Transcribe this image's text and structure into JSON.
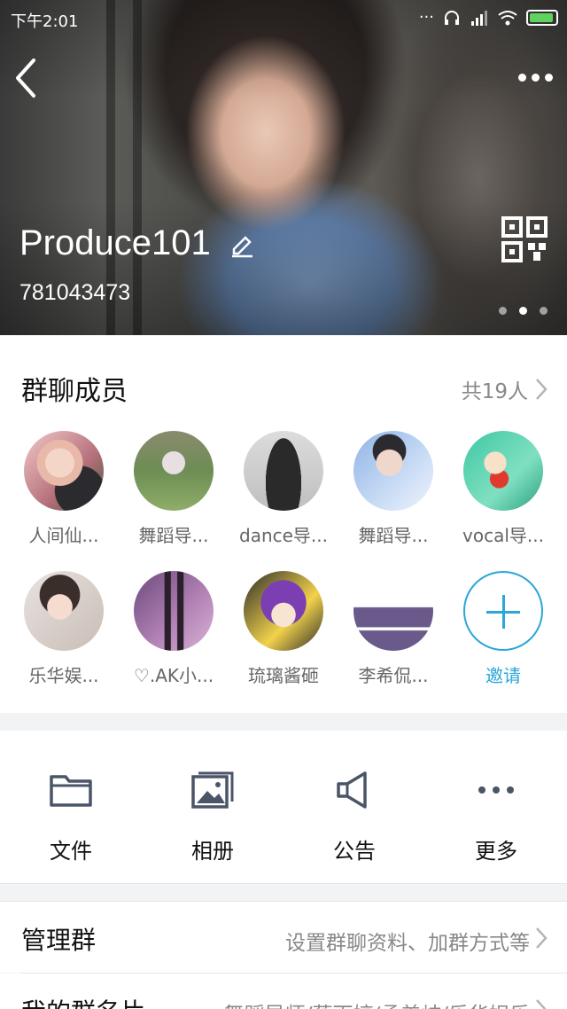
{
  "status_bar": {
    "time": "下午2:01"
  },
  "header": {
    "group_name": "Produce101",
    "group_id": "781043473"
  },
  "members": {
    "title": "群聊成员",
    "count": "共19人",
    "items": [
      {
        "name": "人间仙..."
      },
      {
        "name": "舞蹈导..."
      },
      {
        "name": "dance导..."
      },
      {
        "name": "舞蹈导..."
      },
      {
        "name": "vocal导..."
      },
      {
        "name": "乐华娱..."
      },
      {
        "name": "♡.AK小..."
      },
      {
        "name": "琉璃酱砸"
      },
      {
        "name": "李希侃..."
      }
    ],
    "invite_label": "邀请"
  },
  "actions": [
    {
      "label": "文件",
      "icon": "folder-icon"
    },
    {
      "label": "相册",
      "icon": "album-icon"
    },
    {
      "label": "公告",
      "icon": "announcement-icon"
    },
    {
      "label": "更多",
      "icon": "more-icon"
    }
  ],
  "rows": {
    "manage": {
      "title": "管理群",
      "value": "设置群聊资料、加群方式等"
    },
    "card": {
      "title": "我的群名片",
      "value": "舞蹈导师/蔡雨婷/孟美岐/乐华娱乐"
    }
  },
  "colors": {
    "accent": "#2aa6d8",
    "battery": "#5fd35f"
  }
}
